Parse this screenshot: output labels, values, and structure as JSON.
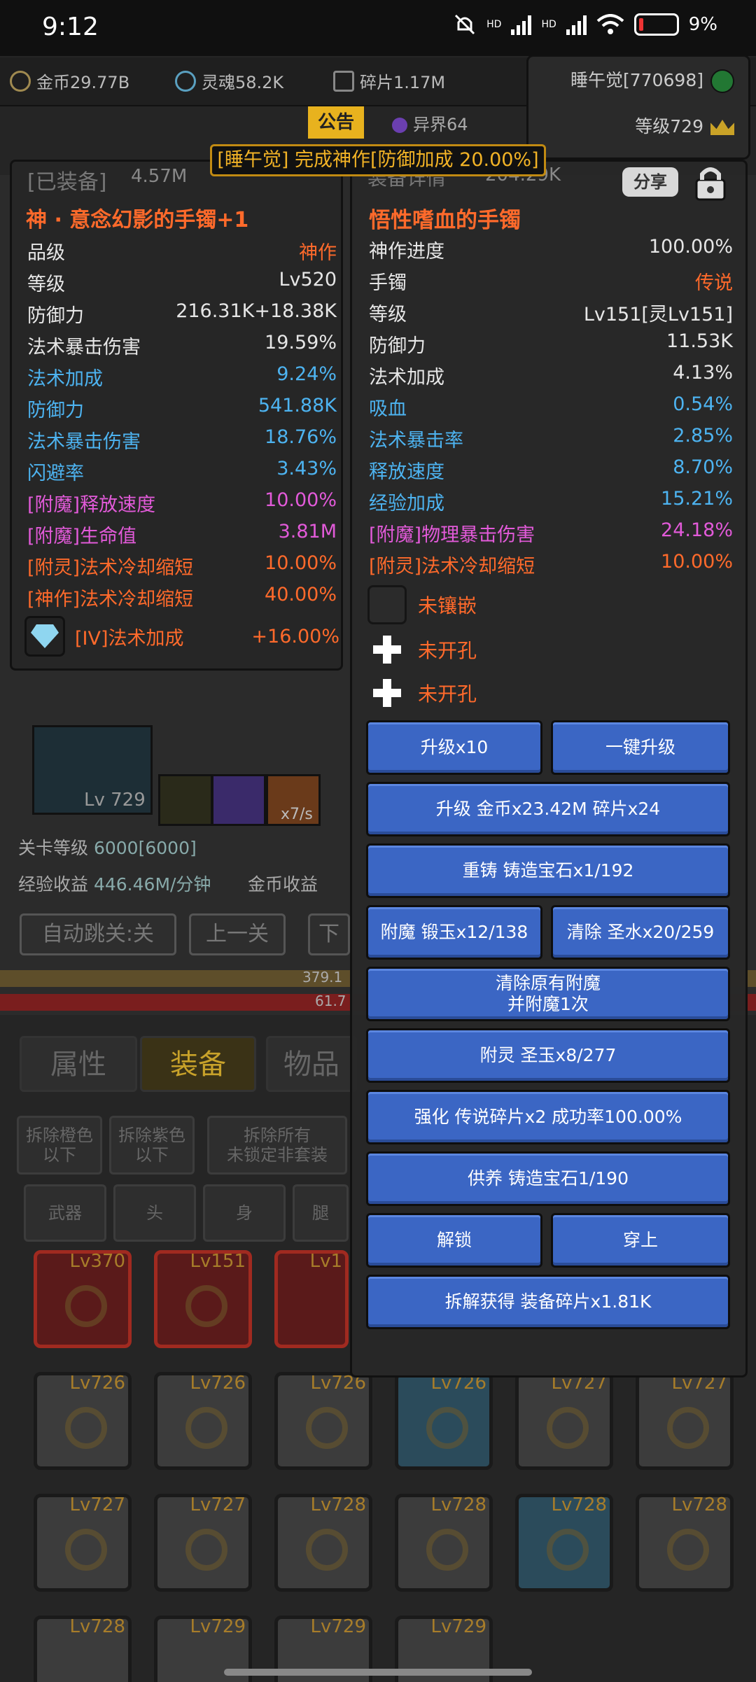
{
  "status_bar": {
    "time": "9:12",
    "hd1": "HD",
    "hd2": "HD",
    "battery": "9%"
  },
  "currency": {
    "gold": "金币29.77B",
    "soul": "灵魂58.2K",
    "shards": "碎片1.17M"
  },
  "player": {
    "name": "睡午觉[770698]",
    "level": "等级729"
  },
  "tabs_top": {
    "notice": "公告",
    "otherworld": "异界64"
  },
  "banner": "[睡午觉] 完成神作[防御加成 20.00%]",
  "equipped_panel": {
    "header": "[已装备]",
    "header_value": "4.57M",
    "name": "神 · 意念幻影的手镯+1",
    "stats": [
      {
        "label": "品级",
        "value": "神作",
        "lc": "w",
        "vc": "o"
      },
      {
        "label": "等级",
        "value": "Lv520",
        "lc": "w",
        "vc": "w"
      },
      {
        "label": "防御力",
        "value": "216.31K+18.38K",
        "lc": "w",
        "vc": "w"
      },
      {
        "label": "法术暴击伤害",
        "value": "19.59%",
        "lc": "w",
        "vc": "w"
      },
      {
        "label": "法术加成",
        "value": "9.24%",
        "lc": "b",
        "vc": "b"
      },
      {
        "label": "防御力",
        "value": "541.88K",
        "lc": "b",
        "vc": "b"
      },
      {
        "label": "法术暴击伤害",
        "value": "18.76%",
        "lc": "b",
        "vc": "b"
      },
      {
        "label": "闪避率",
        "value": "3.43%",
        "lc": "b",
        "vc": "b"
      },
      {
        "label": "[附魔]释放速度",
        "value": "10.00%",
        "lc": "p",
        "vc": "p"
      },
      {
        "label": "[附魔]生命值",
        "value": "3.81M",
        "lc": "p",
        "vc": "p"
      },
      {
        "label": "[附灵]法术冷却缩短",
        "value": "10.00%",
        "lc": "o",
        "vc": "o"
      },
      {
        "label": "[神作]法术冷却缩短",
        "value": "40.00%",
        "lc": "r",
        "vc": "r"
      }
    ],
    "gem": {
      "label": "[IV]法术加成",
      "value": "+16.00%"
    }
  },
  "detail_panel": {
    "header": "装备详情",
    "header_value": "204.29K",
    "share": "分享",
    "name": "悟性嗜血的手镯",
    "stats": [
      {
        "label": "神作进度",
        "value": "100.00%",
        "lc": "w",
        "vc": "w"
      },
      {
        "label": "手镯",
        "value": "传说",
        "lc": "w",
        "vc": "o"
      },
      {
        "label": "等级",
        "value": "Lv151[灵Lv151]",
        "lc": "w",
        "vc": "w"
      },
      {
        "label": "防御力",
        "value": "11.53K",
        "lc": "w",
        "vc": "w"
      },
      {
        "label": "法术加成",
        "value": "4.13%",
        "lc": "w",
        "vc": "w"
      },
      {
        "label": "吸血",
        "value": "0.54%",
        "lc": "b",
        "vc": "b"
      },
      {
        "label": "法术暴击率",
        "value": "2.85%",
        "lc": "b",
        "vc": "b"
      },
      {
        "label": "释放速度",
        "value": "8.70%",
        "lc": "b",
        "vc": "b"
      },
      {
        "label": "经验加成",
        "value": "15.21%",
        "lc": "b",
        "vc": "b"
      },
      {
        "label": "[附魔]物理暴击伤害",
        "value": "24.18%",
        "lc": "p",
        "vc": "p"
      },
      {
        "label": "[附灵]法术冷却缩短",
        "value": "10.00%",
        "lc": "o",
        "vc": "o"
      }
    ],
    "sockets": [
      "未镶嵌",
      "未开孔",
      "未开孔"
    ],
    "buttons": {
      "upgrade10": "升级x10",
      "one_key_upgrade": "一键升级",
      "upgrade": "升级 金币x23.42M 碎片x24",
      "reforge": "重铸 铸造宝石x1/192",
      "enchant": "附魔 锻玉x12/138",
      "clear": "清除 圣水x20/259",
      "clear_enchant_l1": "清除原有附魔",
      "clear_enchant_l2": "并附魔1次",
      "spirit": "附灵 圣玉x8/277",
      "strengthen": "强化 传说碎片x2 成功率100.00%",
      "nurture": "供养 铸造宝石1/190",
      "unlock": "解锁",
      "wear": "穿上",
      "dismantle": "拆解获得 装备碎片x1.81K"
    }
  },
  "game": {
    "hero_level": "Lv 729",
    "skill_rate": "x7/s",
    "stage_label": "关卡等级",
    "stage_value": "6000[6000]",
    "exp_label": "经验收益",
    "exp_value": "446.46M/分钟",
    "gold_label": "金币收益",
    "auto_skip": "自动跳关:关",
    "prev_stage": "上一关",
    "next_stage": "下",
    "bar1": "379.1",
    "bar2": "61.7"
  },
  "bottom_tabs": [
    "属性",
    "装备",
    "物品"
  ],
  "filters": {
    "dismantle_orange": [
      "拆除橙色",
      "以下"
    ],
    "dismantle_purple": [
      "拆除紫色",
      "以下"
    ],
    "dismantle_all": [
      "拆除所有",
      "未锁定非套装"
    ],
    "types": [
      "武器",
      "头",
      "身",
      "腿"
    ]
  },
  "inventory_levels": [
    [
      "Lv370",
      "Lv151",
      "Lv1"
    ],
    [
      "Lv726",
      "Lv726",
      "Lv726",
      "Lv726",
      "Lv727",
      "Lv727"
    ],
    [
      "Lv727",
      "Lv727",
      "Lv728",
      "Lv728",
      "Lv728",
      "Lv728"
    ],
    [
      "Lv728",
      "Lv729",
      "Lv729",
      "Lv729"
    ]
  ]
}
